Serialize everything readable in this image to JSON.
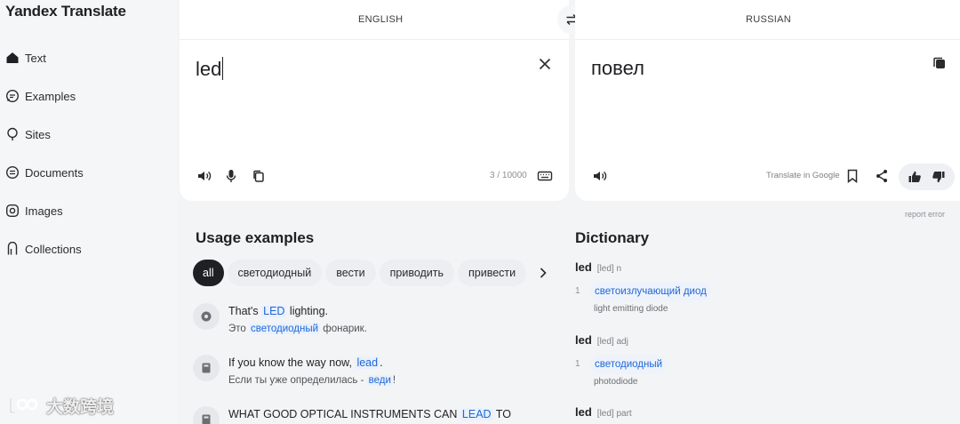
{
  "app": {
    "title": "Yandex Translate"
  },
  "sidebar": {
    "items": [
      {
        "label": "Text",
        "icon": "home-icon"
      },
      {
        "label": "Examples",
        "icon": "speech-bubble-icon"
      },
      {
        "label": "Sites",
        "icon": "globe-pin-icon"
      },
      {
        "label": "Documents",
        "icon": "document-icon"
      },
      {
        "label": "Images",
        "icon": "camera-icon"
      },
      {
        "label": "Collections",
        "icon": "bookmark-icon"
      }
    ]
  },
  "translator": {
    "source_lang": "ENGLISH",
    "target_lang": "RUSSIAN",
    "source_text": "led",
    "target_text": "повел",
    "char_counter": "3 / 10000",
    "translate_in_google": "Translate in Google",
    "report_error": "report error"
  },
  "usage": {
    "title": "Usage examples",
    "chips": [
      "all",
      "светодиодный",
      "вести",
      "приводить",
      "привести"
    ],
    "examples": [
      {
        "icon": "film-reel-icon",
        "en_before": "That's ",
        "en_hl": "LED",
        "en_after": " lighting.",
        "ru_before": "Это ",
        "ru_hl": "светодиодный",
        "ru_after": " фонарик."
      },
      {
        "icon": "book-icon",
        "en_before": "If you know the way now, ",
        "en_hl": "lead",
        "en_after": ".",
        "ru_before": "Если ты уже определилась - ",
        "ru_hl": "веди",
        "ru_after": "!"
      },
      {
        "icon": "book-icon",
        "en_before": "WHAT GOOD OPTICAL INSTRUMENTS CAN ",
        "en_hl": "LEAD",
        "en_after": " TO"
      }
    ]
  },
  "dictionary": {
    "title": "Dictionary",
    "entries": [
      {
        "word": "led",
        "meta": "[led] n",
        "num": "1",
        "translation": "светоизлучающий диод",
        "gloss": "light emitting diode"
      },
      {
        "word": "led",
        "meta": "[led] adj",
        "num": "1",
        "translation": "светодиодный",
        "gloss": "photodiode"
      },
      {
        "word": "led",
        "meta": "[led] part"
      }
    ]
  },
  "watermark": {
    "text": "大数跨境"
  },
  "colors": {
    "accent": "#1f66d6",
    "highlight_bg": "#e9f1fd",
    "chip_active": "#1f2023"
  }
}
